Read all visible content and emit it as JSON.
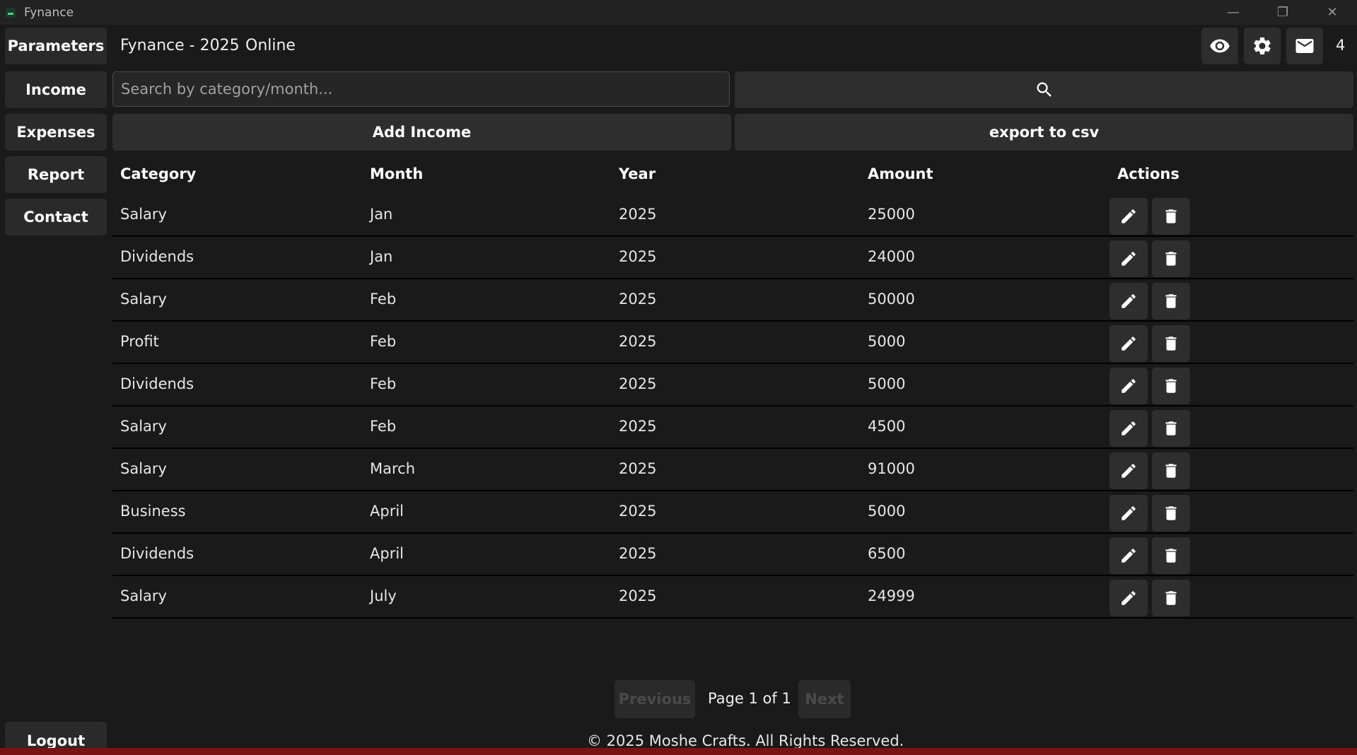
{
  "window": {
    "title": "Fynance"
  },
  "sidebar": {
    "items": [
      {
        "label": "Parameters"
      },
      {
        "label": "Income"
      },
      {
        "label": "Expenses"
      },
      {
        "label": "Report"
      },
      {
        "label": "Contact"
      }
    ],
    "logout_label": "Logout"
  },
  "header": {
    "title": "Fynance - 2025",
    "status": "Online",
    "icons": [
      "eye-icon",
      "gear-icon",
      "mail-icon"
    ],
    "notification_count": "4"
  },
  "search": {
    "placeholder": "Search by category/month...",
    "value": ""
  },
  "actions": {
    "add_label": "Add Income",
    "export_label": "export to csv"
  },
  "table": {
    "columns": [
      "Category",
      "Month",
      "Year",
      "Amount",
      "Actions"
    ],
    "rows": [
      [
        "Salary",
        "Jan",
        "2025",
        "25000"
      ],
      [
        "Dividends",
        "Jan",
        "2025",
        "24000"
      ],
      [
        "Salary",
        "Feb",
        "2025",
        "50000"
      ],
      [
        "Profit",
        "Feb",
        "2025",
        "5000"
      ],
      [
        "Dividends",
        "Feb",
        "2025",
        "5000"
      ],
      [
        "Salary",
        "Feb",
        "2025",
        "4500"
      ],
      [
        "Salary",
        "March",
        "2025",
        "91000"
      ],
      [
        "Business",
        "April",
        "2025",
        "5000"
      ],
      [
        "Dividends",
        "April",
        "2025",
        "6500"
      ],
      [
        "Salary",
        "July",
        "2025",
        "24999"
      ]
    ]
  },
  "pagination": {
    "previous_label": "Previous",
    "page_text": "Page 1 of 1",
    "next_label": "Next"
  },
  "footer": {
    "copyright": "© 2025 Moshe Crafts. All Rights Reserved."
  },
  "colors": {
    "background": "#1a1a1a",
    "button": "#2e2e2e",
    "accent_strip": "#7a1414"
  }
}
